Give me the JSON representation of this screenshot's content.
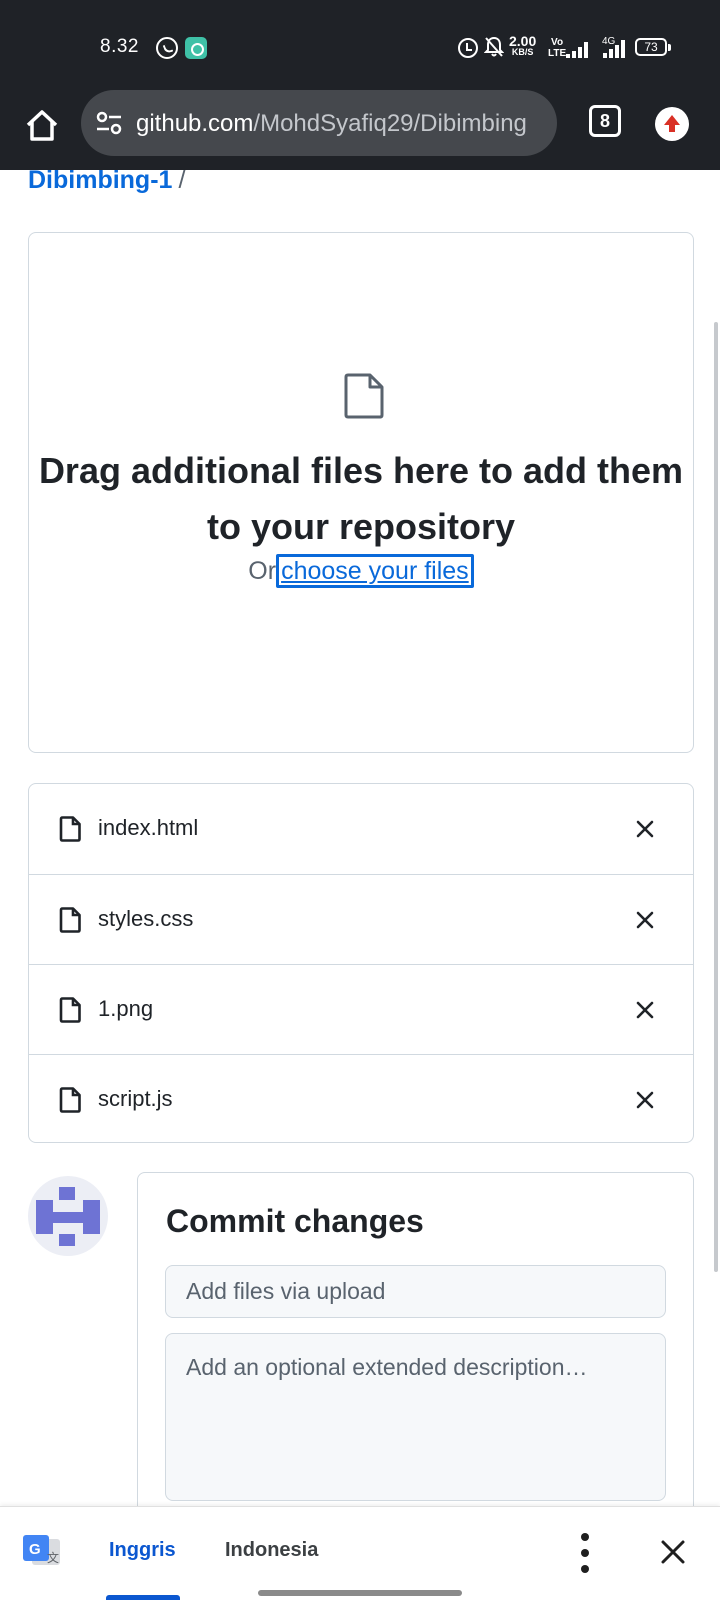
{
  "status_bar": {
    "time": "8.32",
    "net_speed": "2.00",
    "net_speed_unit": "KB/S",
    "volte_top": "Vo",
    "volte_bottom": "LTE",
    "network": "4G",
    "battery": "73"
  },
  "browser": {
    "url_host": "github.com",
    "url_path": "/MohdSyafiq29/Dibimbing",
    "tab_count": "8"
  },
  "breadcrumb": {
    "repo": "Dibimbing-1",
    "separator": "/"
  },
  "dropzone": {
    "title": "Drag additional files here to add them to your repository",
    "or_text": "Or",
    "link_text": "choose your files"
  },
  "files": [
    {
      "name": "index.html"
    },
    {
      "name": "styles.css"
    },
    {
      "name": "1.png"
    },
    {
      "name": "script.js"
    }
  ],
  "commit": {
    "title": "Commit changes",
    "summary_placeholder": "Add files via upload",
    "description_placeholder": "Add an optional extended description…"
  },
  "translate_bar": {
    "source_language": "Inggris",
    "target_language": "Indonesia"
  },
  "colors": {
    "link": "#0969da",
    "border": "#d1d9e0",
    "chrome": "#1f2227",
    "translate_active": "#0b57d0"
  }
}
